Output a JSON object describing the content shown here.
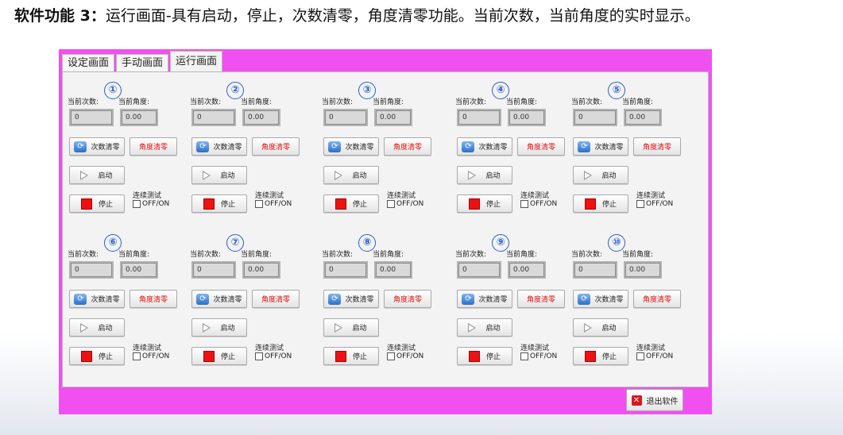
{
  "caption": {
    "bold": "软件功能 3：",
    "text": "运行画面-具有启动，停止，次数清零，角度清零功能。当前次数，当前角度的实时显示。"
  },
  "tabs": [
    "设定画面",
    "手动画面",
    "运行画面"
  ],
  "active_tab": 2,
  "labels": {
    "count": "当前次数:",
    "angle": "当前角度:",
    "clear_count": "次数清零",
    "clear_angle": "角度清零",
    "start": "启动",
    "stop": "停止",
    "continuous": "连续测试",
    "offon": "OFF/ON"
  },
  "groups": [
    {
      "num": "①",
      "count": "0",
      "angle": "0.00"
    },
    {
      "num": "②",
      "count": "0",
      "angle": "0.00"
    },
    {
      "num": "③",
      "count": "0",
      "angle": "0.00"
    },
    {
      "num": "④",
      "count": "0",
      "angle": "0.00"
    },
    {
      "num": "⑤",
      "count": "0",
      "angle": "0.00"
    },
    {
      "num": "⑥",
      "count": "0",
      "angle": "0.00"
    },
    {
      "num": "⑦",
      "count": "0",
      "angle": "0.00"
    },
    {
      "num": "⑧",
      "count": "0",
      "angle": "0.00"
    },
    {
      "num": "⑨",
      "count": "0",
      "angle": "0.00"
    },
    {
      "num": "⑩",
      "count": "0",
      "angle": "0.00"
    }
  ],
  "exit_button": "退出软件",
  "colors": {
    "window_bg": "#f050f0",
    "clear_angle_text": "#e01010",
    "stop_icon": "#ee1111",
    "number_badge": "#2a5fc8"
  }
}
